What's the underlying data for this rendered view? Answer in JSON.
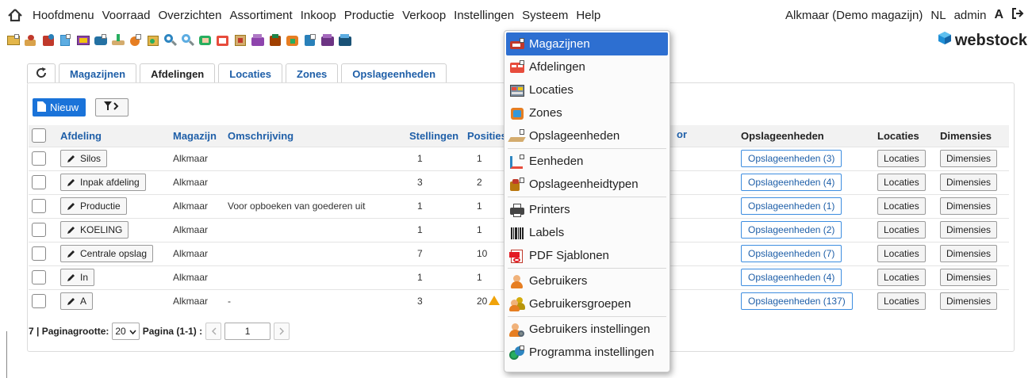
{
  "menubar": {
    "items": [
      "Hoofdmenu",
      "Voorraad",
      "Overzichten",
      "Assortiment",
      "Inkoop",
      "Productie",
      "Verkoop",
      "Instellingen",
      "Systeem",
      "Help"
    ],
    "warehouse": "Alkmaar (Demo magazijn)",
    "language": "NL",
    "user": "admin",
    "font_toggle": "A"
  },
  "logo": {
    "text": "webstock"
  },
  "tabs": [
    "Magazijnen",
    "Afdelingen",
    "Locaties",
    "Zones",
    "Opslageenheden"
  ],
  "active_tab": "Afdelingen",
  "actions": {
    "new_label": "Nieuw"
  },
  "table": {
    "headers": {
      "afdeling": "Afdeling",
      "magazijn": "Magazijn",
      "omschrijving": "Omschrijving",
      "stellingen": "Stellingen",
      "posities": "Posities",
      "hidden_partial": "or",
      "opslageenheden": "Opslageenheden",
      "locaties": "Locaties",
      "dimensies": "Dimensies"
    },
    "rows": [
      {
        "afdeling": "Silos",
        "magazijn": "Alkmaar",
        "omschrijving": "",
        "stellingen": "1",
        "posities": "1",
        "opslag": "Opslageenheden (3)",
        "locaties": "Locaties",
        "dimensies": "Dimensies"
      },
      {
        "afdeling": "Inpak afdeling",
        "magazijn": "Alkmaar",
        "omschrijving": "",
        "stellingen": "3",
        "posities": "2",
        "opslag": "Opslageenheden (4)",
        "locaties": "Locaties",
        "dimensies": "Dimensies"
      },
      {
        "afdeling": "Productie",
        "magazijn": "Alkmaar",
        "omschrijving": "Voor opboeken van goederen uit",
        "stellingen": "1",
        "posities": "1",
        "opslag": "Opslageenheden (1)",
        "locaties": "Locaties",
        "dimensies": "Dimensies"
      },
      {
        "afdeling": "KOELING",
        "magazijn": "Alkmaar",
        "omschrijving": "",
        "stellingen": "1",
        "posities": "1",
        "opslag": "Opslageenheden (2)",
        "locaties": "Locaties",
        "dimensies": "Dimensies"
      },
      {
        "afdeling": "Centrale opslag",
        "magazijn": "Alkmaar",
        "omschrijving": "",
        "stellingen": "7",
        "posities": "10",
        "opslag": "Opslageenheden (7)",
        "locaties": "Locaties",
        "dimensies": "Dimensies"
      },
      {
        "afdeling": "In",
        "magazijn": "Alkmaar",
        "omschrijving": "",
        "stellingen": "1",
        "posities": "1",
        "opslag": "Opslageenheden (4)",
        "locaties": "Locaties",
        "dimensies": "Dimensies"
      },
      {
        "afdeling": "A",
        "magazijn": "Alkmaar",
        "omschrijving": "-",
        "stellingen": "3",
        "posities": "20",
        "opslag": "Opslageenheden (137)",
        "locaties": "Locaties",
        "dimensies": "Dimensies",
        "warning": true
      }
    ]
  },
  "pager": {
    "count": "7 | Paginagrootte:",
    "page_size": "20",
    "page_label": "Pagina (1-1) :",
    "page_value": "1"
  },
  "dropdown": {
    "items": [
      {
        "label": "Magazijnen",
        "icon": "warehouse-icon",
        "active": true
      },
      {
        "label": "Afdelingen",
        "icon": "departments-icon"
      },
      {
        "label": "Locaties",
        "icon": "locations-icon"
      },
      {
        "label": "Zones",
        "icon": "zones-icon"
      },
      {
        "label": "Opslageenheden",
        "icon": "storage-units-icon",
        "sep_after": true
      },
      {
        "label": "Eenheden",
        "icon": "units-icon"
      },
      {
        "label": "Opslageenheidtypen",
        "icon": "storage-types-icon",
        "sep_after": true
      },
      {
        "label": "Printers",
        "icon": "printer-icon"
      },
      {
        "label": "Labels",
        "icon": "barcode-icon"
      },
      {
        "label": "PDF Sjablonen",
        "icon": "pdf-icon",
        "sep_after": true
      },
      {
        "label": "Gebruikers",
        "icon": "user-icon"
      },
      {
        "label": "Gebruikersgroepen",
        "icon": "user-group-icon",
        "sep_after": true
      },
      {
        "label": "Gebruikers instellingen",
        "icon": "user-settings-icon"
      },
      {
        "label": "Programma instellingen",
        "icon": "program-settings-icon"
      }
    ]
  },
  "colors": {
    "accent": "#2d6fd1",
    "link": "#1f5fa8",
    "primary_button": "#1a73d9"
  }
}
